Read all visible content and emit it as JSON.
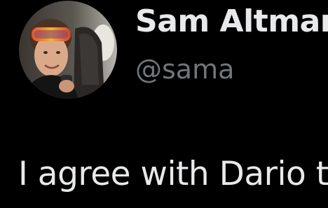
{
  "author": {
    "display_name": "Sam Altman",
    "handle": "@sama",
    "avatar_icon": "profile-photo"
  },
  "tweet": {
    "text": "I agree with Dario t"
  },
  "colors": {
    "background": "#000000",
    "primary_text": "#e7e9ea",
    "secondary_text": "#71767b"
  }
}
